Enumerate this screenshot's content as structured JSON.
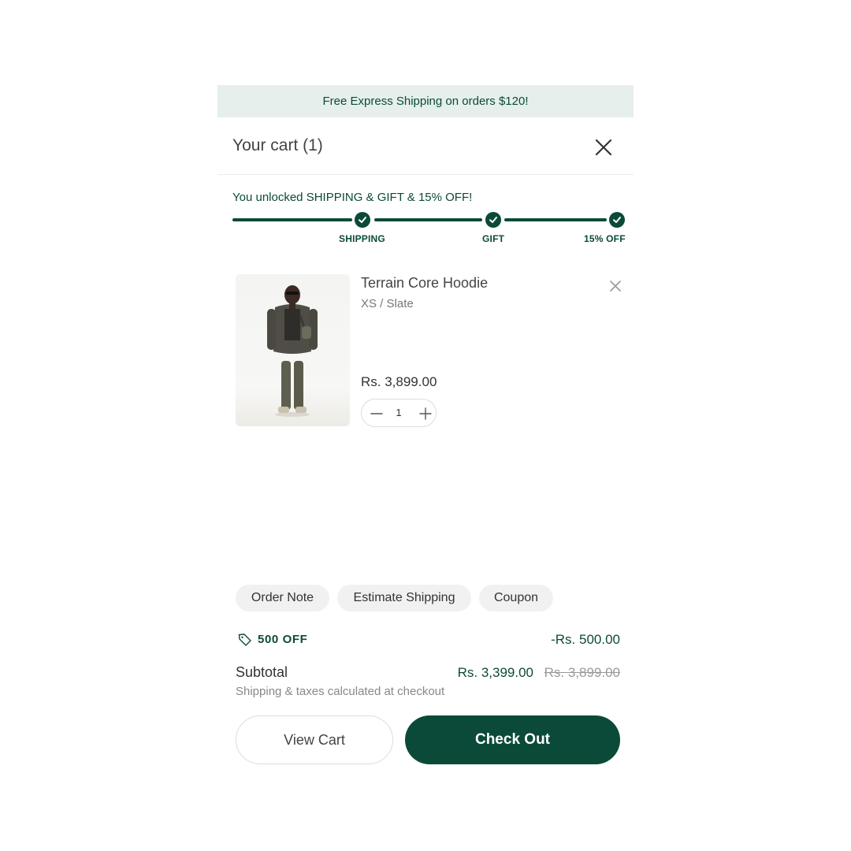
{
  "announcement": "Free Express Shipping on orders $120!",
  "cart": {
    "title": "Your cart (1)"
  },
  "rewards": {
    "message": "You unlocked SHIPPING & GIFT & 15% OFF!",
    "progress_percent": 100,
    "milestones": [
      {
        "label": "SHIPPING",
        "unlocked": true
      },
      {
        "label": "GIFT",
        "unlocked": true
      },
      {
        "label": "15% OFF",
        "unlocked": true
      }
    ]
  },
  "item": {
    "name": "Terrain Core Hoodie",
    "variant": "XS / Slate",
    "price": "Rs. 3,899.00",
    "quantity": "1"
  },
  "actions": {
    "chips": [
      "Order Note",
      "Estimate Shipping",
      "Coupon"
    ]
  },
  "discount": {
    "label": "500 OFF",
    "amount": "-Rs. 500.00"
  },
  "subtotal": {
    "label": "Subtotal",
    "new_price": "Rs. 3,399.00",
    "old_price": "Rs. 3,899.00",
    "note": "Shipping & taxes calculated at checkout"
  },
  "buttons": {
    "view_cart": "View Cart",
    "checkout": "Check Out"
  },
  "colors": {
    "accent": "#0b4a39",
    "banner_bg": "#e6efeb"
  }
}
